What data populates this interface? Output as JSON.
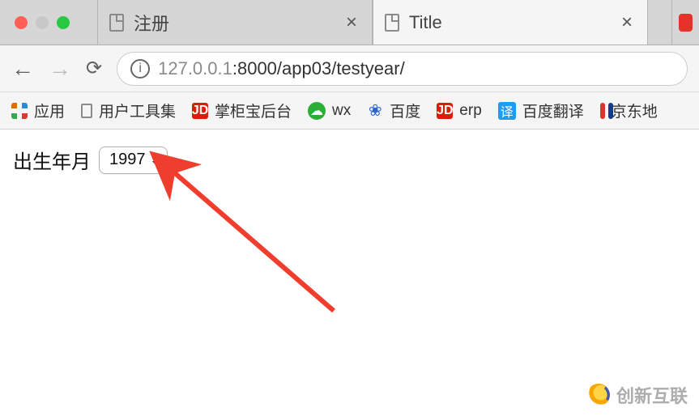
{
  "tabs": {
    "items": [
      {
        "title": "注册",
        "active": false
      },
      {
        "title": "Title",
        "active": true
      }
    ]
  },
  "address_bar": {
    "url_muted_prefix": "127.0.0.1",
    "url_rest": ":8000/app03/testyear/"
  },
  "bookmarks_bar": {
    "apps_label": "应用",
    "items": [
      {
        "label": "用户工具集",
        "icon": "file"
      },
      {
        "label": "掌柜宝后台",
        "icon": "jd"
      },
      {
        "label": "wx",
        "icon": "wx"
      },
      {
        "label": "百度",
        "icon": "baidu"
      },
      {
        "label": "erp",
        "icon": "jd"
      },
      {
        "label": "百度翻译",
        "icon": "yi"
      },
      {
        "label": "京东地",
        "icon": "jd-addr"
      }
    ]
  },
  "page": {
    "form": {
      "birth_label": "出生年月",
      "year_value": "1997"
    }
  },
  "annotation": {
    "arrow_color": "#ef3d2e"
  },
  "watermark": {
    "text": "创新互联"
  }
}
